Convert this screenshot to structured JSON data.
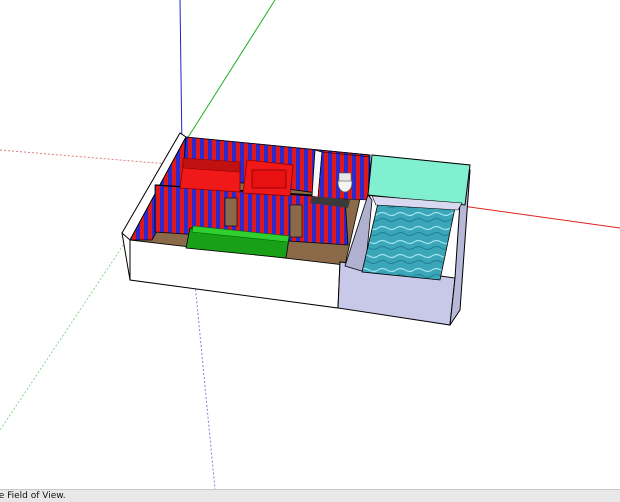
{
  "viewport": {
    "background": "#ffffff",
    "axis_colors": {
      "red": "#e02020",
      "green": "#20b020",
      "blue": "#2020d0"
    }
  },
  "model": {
    "colors": {
      "wall_stripe_red": "#e01818",
      "wall_stripe_blue": "#2a2ad0",
      "wall_dark": "#000040",
      "outer_wall": "#ffffff",
      "floor": "#8a6a48",
      "sofa": "#f01818",
      "table": "#18a018",
      "pool_water": "#3aa6b8",
      "pool_wall": "#c8c8e8",
      "pool_glass": "#80f0d0"
    }
  },
  "statusbar": {
    "text": "ge Field of View."
  }
}
